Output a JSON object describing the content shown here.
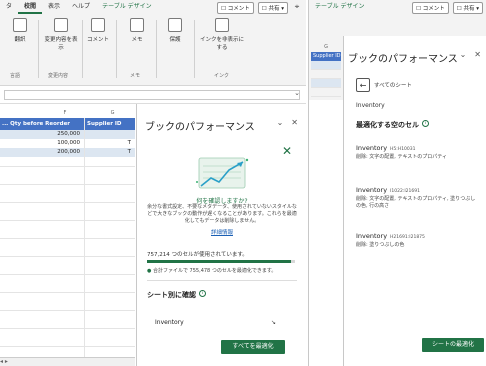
{
  "left_window": {
    "tabs": [
      {
        "label": "タ",
        "style": "normal"
      },
      {
        "label": "校閲",
        "style": "active"
      },
      {
        "label": "表示",
        "style": "normal"
      },
      {
        "label": "ヘルプ",
        "style": "normal"
      },
      {
        "label": "テーブル デザイン",
        "style": "green"
      }
    ],
    "comment_btn": "コメント",
    "share_btn": "共有",
    "ribbon": {
      "buttons": [
        "翻訳",
        "変更内容を表示",
        "コメント",
        "メモ",
        "保護",
        "インクを非表示にする"
      ],
      "groups": [
        "言語",
        "変更内容",
        "メモ",
        "インク"
      ]
    },
    "grid": {
      "col_letter": "F",
      "col_letter2": "G",
      "headers": [
        "... Qty before Reorder",
        "Supplier ID"
      ],
      "rows": [
        [
          "250,000",
          ""
        ],
        [
          "100,000",
          "T"
        ],
        [
          "200,000",
          "T"
        ]
      ]
    },
    "pane": {
      "title": "ブックのパフォーマンス",
      "question": "何を確認しますか?",
      "description": "余分な書式設定、不要なメタデータ、使用されていないスタイルなどで大きなブックの動作が遅くなることがあります。これらを最適化してもデータは削除しません。",
      "link": "詳細情報",
      "used": "757,214 つのセルが使用されています。",
      "progress": 0.97,
      "optimizable": "合計ファイルで 755,478 つのセルを最適化できます。",
      "by_sheet": "シート別に確認",
      "sheet_name": "Inventory",
      "action_button": "すべてを最適化"
    }
  },
  "right_window": {
    "tab": "テーブル デザイン",
    "comment_btn": "コメント",
    "share_btn": "共有",
    "grid": {
      "col_letter": "G",
      "header": "Supplier ID"
    },
    "pane": {
      "title": "ブックのパフォーマンス",
      "back_label": "すべてのシート",
      "sheet_name": "Inventory",
      "section_title": "最適化する空のセル",
      "cards": [
        {
          "name": "Inventory",
          "range": "H5:H10031",
          "desc": "削除: 文字の配置, テキストのプロパティ"
        },
        {
          "name": "Inventory",
          "range": "I1022:I21691",
          "desc": "削除: 文字の配置, テキストのプロパティ, 塗りつぶしの色, 行の高さ"
        },
        {
          "name": "Inventory",
          "range": "H21691:I21875",
          "desc": "削除: 塗りつぶしの色"
        }
      ],
      "action_button": "シートの最適化"
    }
  },
  "colors": {
    "accent": "#217346",
    "table_header": "#4472c4",
    "link": "#1a5fb4"
  }
}
